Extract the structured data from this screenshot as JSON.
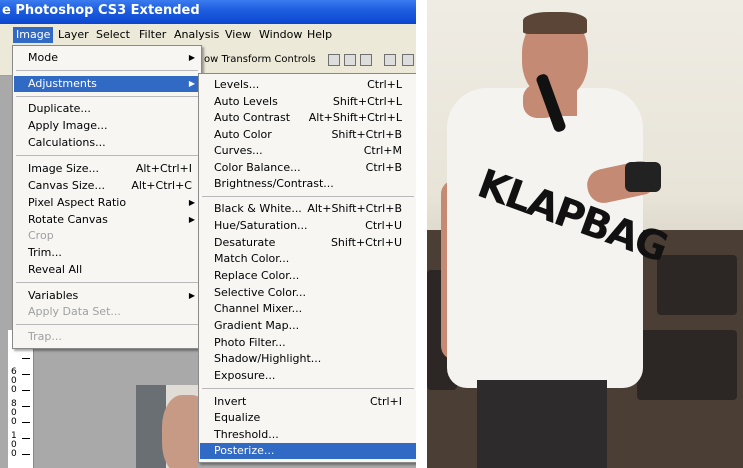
{
  "window": {
    "title": "e Photoshop CS3 Extended"
  },
  "menubar": {
    "items": [
      "Image",
      "Layer",
      "Select",
      "Filter",
      "Analysis",
      "View",
      "Window",
      "Help"
    ],
    "active": "Image"
  },
  "optionsbar": {
    "text": "ow Transform Controls"
  },
  "image_menu": {
    "items": [
      {
        "label": "Mode",
        "submenu": true
      },
      {
        "label": "Adjustments",
        "submenu": true,
        "highlighted": true
      },
      {
        "label": "Duplicate..."
      },
      {
        "label": "Apply Image..."
      },
      {
        "label": "Calculations..."
      },
      {
        "label": "Image Size...",
        "shortcut": "Alt+Ctrl+I"
      },
      {
        "label": "Canvas Size...",
        "shortcut": "Alt+Ctrl+C"
      },
      {
        "label": "Pixel Aspect Ratio",
        "submenu": true
      },
      {
        "label": "Rotate Canvas",
        "submenu": true
      },
      {
        "label": "Crop",
        "disabled": true
      },
      {
        "label": "Trim..."
      },
      {
        "label": "Reveal All"
      },
      {
        "label": "Variables",
        "submenu": true
      },
      {
        "label": "Apply Data Set...",
        "disabled": true
      },
      {
        "label": "Trap...",
        "disabled": true
      }
    ]
  },
  "adjustments_menu": {
    "items": [
      {
        "label": "Levels...",
        "shortcut": "Ctrl+L"
      },
      {
        "label": "Auto Levels",
        "shortcut": "Shift+Ctrl+L"
      },
      {
        "label": "Auto Contrast",
        "shortcut": "Alt+Shift+Ctrl+L"
      },
      {
        "label": "Auto Color",
        "shortcut": "Shift+Ctrl+B"
      },
      {
        "label": "Curves...",
        "shortcut": "Ctrl+M"
      },
      {
        "label": "Color Balance...",
        "shortcut": "Ctrl+B"
      },
      {
        "label": "Brightness/Contrast..."
      },
      {
        "label": "Black & White...",
        "shortcut": "Alt+Shift+Ctrl+B"
      },
      {
        "label": "Hue/Saturation...",
        "shortcut": "Ctrl+U"
      },
      {
        "label": "Desaturate",
        "shortcut": "Shift+Ctrl+U"
      },
      {
        "label": "Match Color..."
      },
      {
        "label": "Replace Color..."
      },
      {
        "label": "Selective Color..."
      },
      {
        "label": "Channel Mixer..."
      },
      {
        "label": "Gradient Map..."
      },
      {
        "label": "Photo Filter..."
      },
      {
        "label": "Shadow/Highlight..."
      },
      {
        "label": "Exposure..."
      },
      {
        "label": "Invert",
        "shortcut": "Ctrl+I"
      },
      {
        "label": "Equalize"
      },
      {
        "label": "Threshold..."
      },
      {
        "label": "Posterize...",
        "highlighted": true
      }
    ]
  },
  "ruler": {
    "labels": [
      "6\n0\n0",
      "8\n0\n0",
      "1\n0\n0"
    ]
  },
  "photo": {
    "shirt_text": "KLAPBAG"
  },
  "colors": {
    "menu_highlight": "#316ac5",
    "menu_bg": "#f7f6f3",
    "titlebar": "#1f5fe0"
  }
}
